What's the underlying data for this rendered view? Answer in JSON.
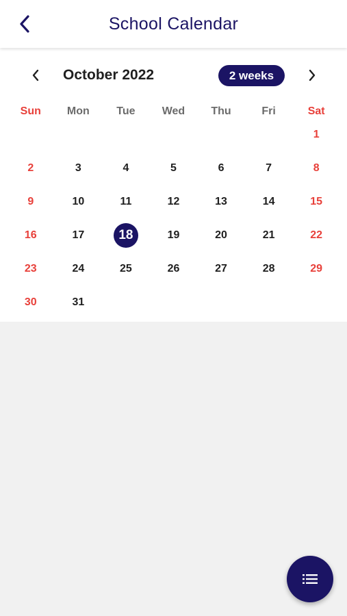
{
  "header": {
    "title": "School Calendar",
    "back_icon": "chevron-left-icon"
  },
  "calendar": {
    "month_label": "October 2022",
    "view_toggle_label": "2 weeks",
    "prev_icon": "chevron-left-icon",
    "next_icon": "chevron-right-icon",
    "weekdays": [
      "Sun",
      "Mon",
      "Tue",
      "Wed",
      "Thu",
      "Fri",
      "Sat"
    ],
    "weeks": [
      [
        "",
        "",
        "",
        "",
        "",
        "",
        "1"
      ],
      [
        "2",
        "3",
        "4",
        "5",
        "6",
        "7",
        "8"
      ],
      [
        "9",
        "10",
        "11",
        "12",
        "13",
        "14",
        "15"
      ],
      [
        "16",
        "17",
        "18",
        "19",
        "20",
        "21",
        "22"
      ],
      [
        "23",
        "24",
        "25",
        "26",
        "27",
        "28",
        "29"
      ],
      [
        "30",
        "31",
        "",
        "",
        "",
        "",
        ""
      ]
    ],
    "selected_day": "18"
  },
  "fab": {
    "icon": "list-icon"
  },
  "colors": {
    "brand": "#1b1464",
    "weekend": "#e8403a",
    "background": "#f1f1f1"
  }
}
